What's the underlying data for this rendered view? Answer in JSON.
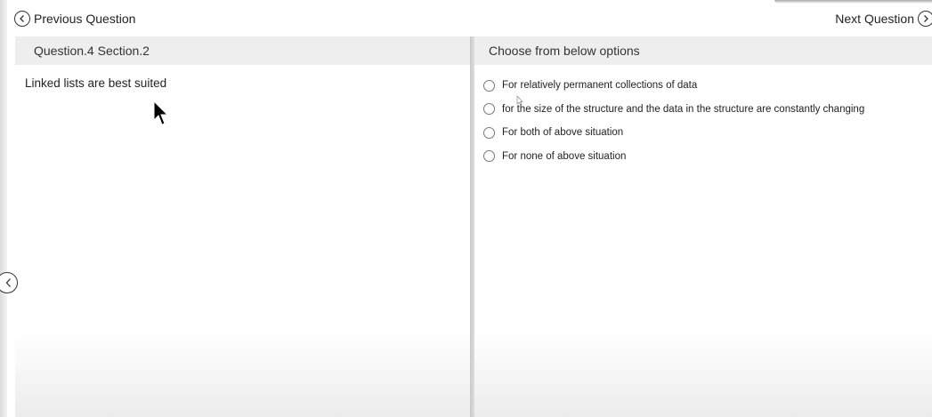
{
  "nav": {
    "previous_label": "Previous Question",
    "next_label": "Next Question",
    "previous_icon": "chevron-left-circle-icon",
    "next_icon": "chevron-right-circle-icon"
  },
  "question_panel": {
    "header": "Question.4 Section.2",
    "text": "Linked lists are best suited"
  },
  "options_panel": {
    "header": "Choose from below options",
    "options": [
      {
        "label": "For relatively permanent collections of data"
      },
      {
        "label": "for the size of the structure and the data in the structure are constantly changing"
      },
      {
        "label": "For both of above situation"
      },
      {
        "label": "For none of above situation"
      }
    ]
  },
  "side_back_icon": "chevron-left-circle-icon",
  "colors": {
    "header_bg": "#eeeeee",
    "divider": "#cfcfcf",
    "text": "#222222"
  }
}
